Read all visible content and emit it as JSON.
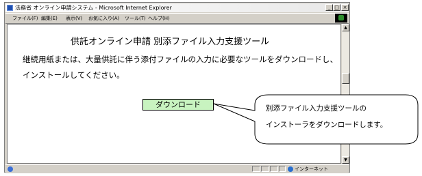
{
  "window": {
    "title": "法務省 オンライン申請システム - Microsoft Internet Explorer",
    "minimize_label": "_",
    "maximize_label": "□",
    "close_label": "×"
  },
  "menubar": {
    "items": [
      "ファイル(F)",
      "編集(E)",
      "表示(V)",
      "お気に入り(A)",
      "ツール(T)",
      "ヘルプ(H)"
    ]
  },
  "page": {
    "title": "供託オンライン申請 別添ファイル入力支援ツール",
    "description": "継続用紙または、大量供託に伴う添付ファイルの入力に必要なツールをダウンロードし、インストールしてください。",
    "download_button": "ダウンロード"
  },
  "scrollbar": {
    "up_arrow": "▲",
    "down_arrow": "▼"
  },
  "statusbar": {
    "zone": "インターネット"
  },
  "callout": {
    "line1": "別添ファイル入力支援ツールの",
    "line2": "インストーラをダウンロードします。"
  }
}
